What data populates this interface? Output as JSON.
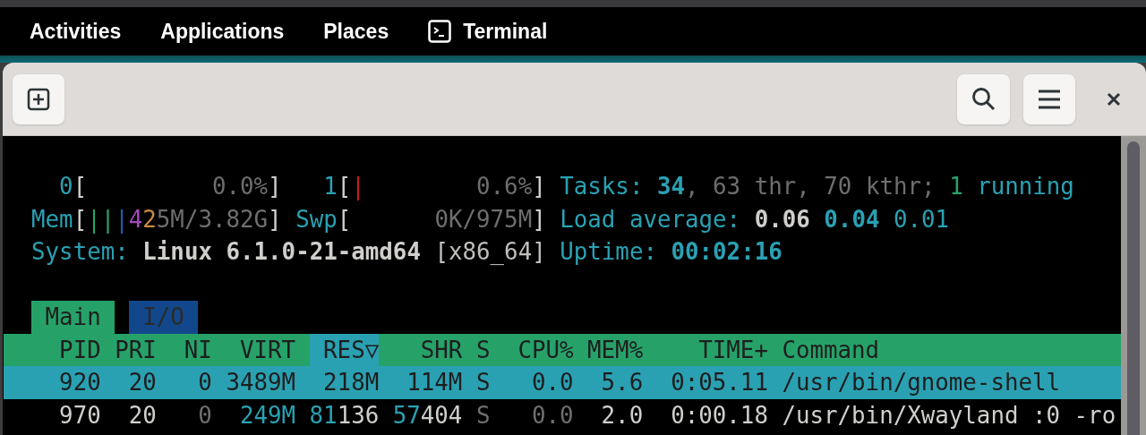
{
  "top_bar": {
    "menus": [
      {
        "label": "Activities"
      },
      {
        "label": "Applications"
      },
      {
        "label": "Places"
      }
    ],
    "app_menu": {
      "label": "Terminal"
    }
  },
  "htop": {
    "meters": [
      [
        {
          "text": "    0",
          "color": "#2aa1b3"
        },
        {
          "text": "[",
          "color": "#d0cfcc"
        },
        {
          "text": "         0.0%",
          "color": "#6e6d70"
        },
        {
          "text": "]",
          "color": "#d0cfcc"
        },
        {
          "text": "   1",
          "color": "#2aa1b3"
        },
        {
          "text": "[",
          "color": "#d0cfcc"
        },
        {
          "text": "|",
          "color": "#c01c28"
        },
        {
          "text": "        0.6%",
          "color": "#6e6d70"
        },
        {
          "text": "]",
          "color": "#d0cfcc"
        },
        {
          "text": " Tasks: ",
          "color": "#2aa1b3"
        },
        {
          "text": "34",
          "color": "#2aa1b3",
          "bold": true
        },
        {
          "text": ", 63 thr, 70 kthr; ",
          "color": "#6e6d70"
        },
        {
          "text": "1",
          "color": "#26a269"
        },
        {
          "text": " running",
          "color": "#2aa1b3"
        }
      ],
      [
        {
          "text": "  Mem",
          "color": "#2aa1b3"
        },
        {
          "text": "[",
          "color": "#d0cfcc"
        },
        {
          "text": "||",
          "color": "#26a269"
        },
        {
          "text": "|",
          "color": "#1c5fb4"
        },
        {
          "text": "4",
          "color": "#a347ba"
        },
        {
          "text": "2",
          "color": "#c88a44"
        },
        {
          "text": "5M/3.82G",
          "color": "#6e6d70"
        },
        {
          "text": "]",
          "color": "#d0cfcc"
        },
        {
          "text": " Swp",
          "color": "#2aa1b3"
        },
        {
          "text": "[",
          "color": "#d0cfcc"
        },
        {
          "text": "      0K/975M",
          "color": "#6e6d70"
        },
        {
          "text": "]",
          "color": "#d0cfcc"
        },
        {
          "text": " Load average: ",
          "color": "#2aa1b3"
        },
        {
          "text": "0.06 ",
          "color": "#d0cfcc",
          "bold": true
        },
        {
          "text": "0.04",
          "color": "#2aa1b3",
          "bold": true
        },
        {
          "text": " 0.01",
          "color": "#2aa1b3"
        }
      ],
      [
        {
          "text": "  System: ",
          "color": "#2aa1b3"
        },
        {
          "text": "Linux 6.1.0-21-amd64",
          "color": "#d0cfcc",
          "bold": true
        },
        {
          "text": " [x86_64]",
          "color": "#c0bfbc"
        },
        {
          "text": " Uptime: ",
          "color": "#2aa1b3"
        },
        {
          "text": "00:02:16",
          "color": "#2aa1b3",
          "bold": true
        }
      ]
    ],
    "tabs": [
      {
        "label": "Main",
        "selected": true
      },
      {
        "label": "I/O",
        "selected": false
      }
    ],
    "columns": [
      {
        "label": "PID",
        "sorted": false
      },
      {
        "label": "PRI",
        "sorted": false
      },
      {
        "label": "NI",
        "sorted": false
      },
      {
        "label": "VIRT",
        "sorted": false
      },
      {
        "label": "RES▽",
        "sorted": true
      },
      {
        "label": "SHR",
        "sorted": false
      },
      {
        "label": "S",
        "sorted": false
      },
      {
        "label": "CPU%",
        "sorted": false
      },
      {
        "label": "MEM%",
        "sorted": false
      },
      {
        "label": "TIME+",
        "sorted": false
      },
      {
        "label": "Command",
        "sorted": false
      }
    ],
    "rows": [
      {
        "selected": true,
        "cells": [
          [
            {
              "text": "920"
            }
          ],
          [
            {
              "text": "20"
            }
          ],
          [
            {
              "text": "0"
            }
          ],
          [
            {
              "text": "3489M"
            }
          ],
          [
            {
              "text": "218M"
            }
          ],
          [
            {
              "text": "114M"
            }
          ],
          [
            {
              "text": "S"
            }
          ],
          [
            {
              "text": "0.0"
            }
          ],
          [
            {
              "text": "5.6"
            }
          ],
          [
            {
              "text": "0:05.11"
            }
          ],
          [
            {
              "text": "/usr/bin/gnome-shell"
            }
          ]
        ]
      },
      {
        "selected": false,
        "cells": [
          [
            {
              "text": "970",
              "color": "#d0cfcc"
            }
          ],
          [
            {
              "text": "20",
              "color": "#d0cfcc"
            }
          ],
          [
            {
              "text": "0",
              "color": "#6e6d70"
            }
          ],
          [
            {
              "text": "249M",
              "color": "#2aa1b3"
            }
          ],
          [
            {
              "text": "81",
              "color": "#2aa1b3"
            },
            {
              "text": "136",
              "color": "#d0cfcc"
            }
          ],
          [
            {
              "text": "57",
              "color": "#2aa1b3"
            },
            {
              "text": "404",
              "color": "#d0cfcc"
            }
          ],
          [
            {
              "text": "S",
              "color": "#6e6d70"
            }
          ],
          [
            {
              "text": "0.0",
              "color": "#6e6d70"
            }
          ],
          [
            {
              "text": "2.0",
              "color": "#d0cfcc"
            }
          ],
          [
            {
              "text": "0:00.18",
              "color": "#d0cfcc"
            }
          ],
          [
            {
              "text": "/usr/bin/Xwayland :0 -ro",
              "color": "#d0cfcc"
            }
          ]
        ]
      }
    ]
  }
}
